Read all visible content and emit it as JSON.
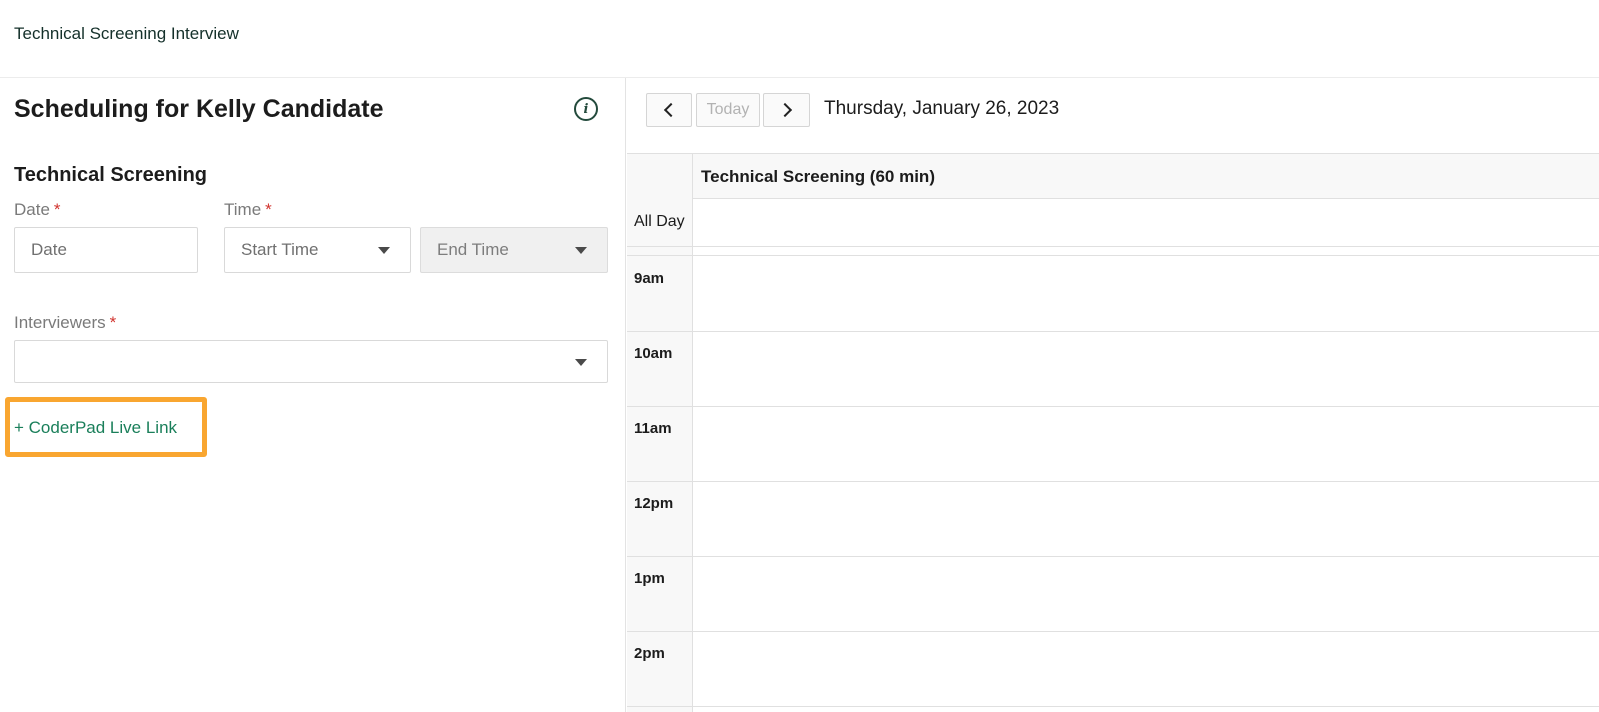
{
  "app": {
    "title": "Technical Screening Interview"
  },
  "left_panel": {
    "heading": "Scheduling for Kelly Candidate",
    "section_title": "Technical Screening",
    "date": {
      "label": "Date",
      "required_mark": "*",
      "placeholder": "Date"
    },
    "time": {
      "label": "Time",
      "required_mark": "*",
      "start_placeholder": "Start Time",
      "end_placeholder": "End Time"
    },
    "interviewers": {
      "label": "Interviewers",
      "required_mark": "*",
      "value": ""
    },
    "coderpad_link": "+ CoderPad Live Link"
  },
  "calendar": {
    "today_label": "Today",
    "date_title": "Thursday, January 26, 2023",
    "column_header": "Technical Screening (60 min)",
    "all_day_label": "All Day",
    "hours": [
      "9am",
      "10am",
      "11am",
      "12pm",
      "1pm",
      "2pm"
    ]
  },
  "colors": {
    "accent_green": "#1a7f5a",
    "highlight_orange": "#f9a630",
    "required_red": "#d1332e"
  }
}
